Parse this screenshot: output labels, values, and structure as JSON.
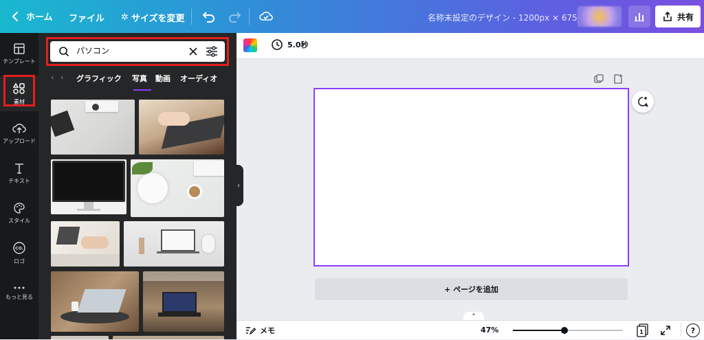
{
  "topbar": {
    "home_label": "ホーム",
    "file_label": "ファイル",
    "resize_label": "サイズを変更",
    "title": "名称未設定のデザイン - 1200px × 675px",
    "share_label": "共有"
  },
  "rail": {
    "items": [
      {
        "label": "テンプレート",
        "icon": "template-icon"
      },
      {
        "label": "素材",
        "icon": "elements-icon"
      },
      {
        "label": "アップロード",
        "icon": "upload-icon"
      },
      {
        "label": "テキスト",
        "icon": "text-icon"
      },
      {
        "label": "スタイル",
        "icon": "palette-icon"
      },
      {
        "label": "ロゴ",
        "icon": "logo-icon"
      },
      {
        "label": "もっと見る",
        "icon": "more-icon"
      }
    ]
  },
  "panel": {
    "search_value": "パソコン",
    "tabs": [
      {
        "label": "グラフィック"
      },
      {
        "label": "写真"
      },
      {
        "label": "動画"
      },
      {
        "label": "オーディオ"
      }
    ]
  },
  "canvas": {
    "duration": "5.0秒",
    "add_page_label": "+ ページを追加",
    "accent_color": "#8b3dff"
  },
  "bottombar": {
    "notes_label": "メモ",
    "zoom": "47%",
    "zoom_fraction": 0.47,
    "page_count": "1",
    "help_label": "?"
  }
}
